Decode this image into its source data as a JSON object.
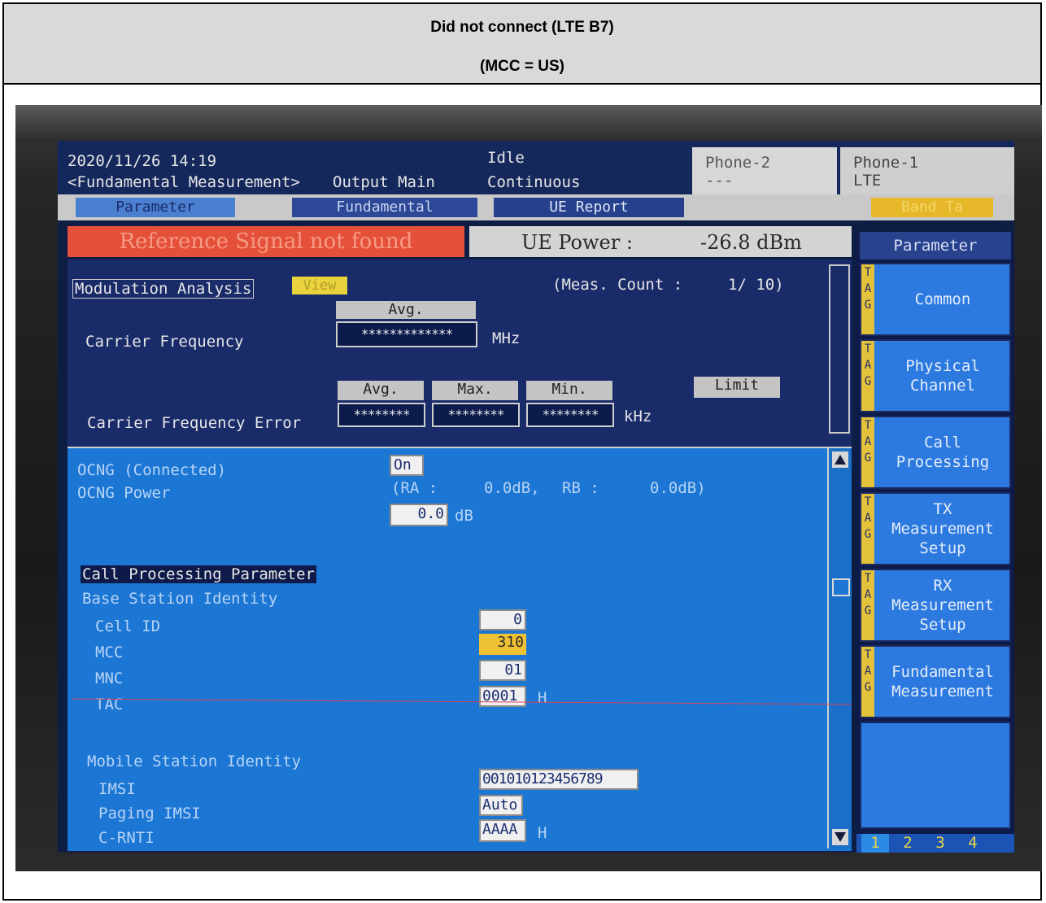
{
  "caption": {
    "line1": "Did not connect (LTE B7)",
    "line2": "(MCC = US)"
  },
  "status_bar": {
    "datetime": "2020/11/26 14:19",
    "screen_name": "<Fundamental Measurement>",
    "output": "Output Main",
    "state": "Idle",
    "mode": "Continuous",
    "phone2": {
      "label": "Phone-2",
      "value": "---"
    },
    "phone1": {
      "label": "Phone-1",
      "value": "LTE"
    }
  },
  "tabs": {
    "parameter": "Parameter",
    "fundamental": "Fundamental",
    "ue_report": "UE Report",
    "band": "Band Ta"
  },
  "alert": "Reference Signal not found",
  "ue_power": {
    "label": "UE Power :",
    "value": "-26.8 dBm"
  },
  "modulation": {
    "title": "Modulation Analysis",
    "view_button": "View",
    "meas_count_label": "(Meas. Count :",
    "meas_count_value": "1/  10)",
    "avg_label": "Avg.",
    "carrier_freq_label": "Carrier Frequency",
    "carrier_freq_value": "*************",
    "carrier_freq_unit": "MHz",
    "cfe_label": "Carrier Frequency Error",
    "col_avg": "Avg.",
    "col_max": "Max.",
    "col_min": "Min.",
    "limit_button": "Limit",
    "cfe_avg": "********",
    "cfe_max": "********",
    "cfe_min": "********",
    "cfe_unit": "kHz"
  },
  "ocng": {
    "connected_label": "OCNG (Connected)",
    "connected_value": "On",
    "power_label": "OCNG Power",
    "ra_label": "(RA :",
    "ra_value": "0.0dB,",
    "rb_label": "RB :",
    "rb_value": "0.0dB)",
    "power_value": "0.0",
    "power_unit": "dB"
  },
  "call_processing": {
    "section": "Call Processing Parameter",
    "bsi": "Base Station Identity",
    "cell_id_label": "Cell ID",
    "cell_id_value": "0",
    "mcc_label": "MCC",
    "mcc_value": "310",
    "mnc_label": "MNC",
    "mnc_value": "01",
    "tac_label": "TAC",
    "tac_value": "0001",
    "tac_unit": "H",
    "msi": "Mobile Station Identity",
    "imsi_label": "IMSI",
    "imsi_value": "001010123456789",
    "paging_label": "Paging IMSI",
    "paging_value": "Auto",
    "crnti_label": "C-RNTI",
    "crnti_value": "AAAA",
    "crnti_unit": "H"
  },
  "sidebar": {
    "header": "Parameter",
    "tag": "TAG",
    "items": [
      "Common",
      "Physical\nChannel",
      "Call\nProcessing",
      "TX\nMeasurement\nSetup",
      "RX\nMeasurement\nSetup",
      "Fundamental\nMeasurement"
    ],
    "pages": [
      "1",
      "2",
      "3",
      "4"
    ]
  }
}
